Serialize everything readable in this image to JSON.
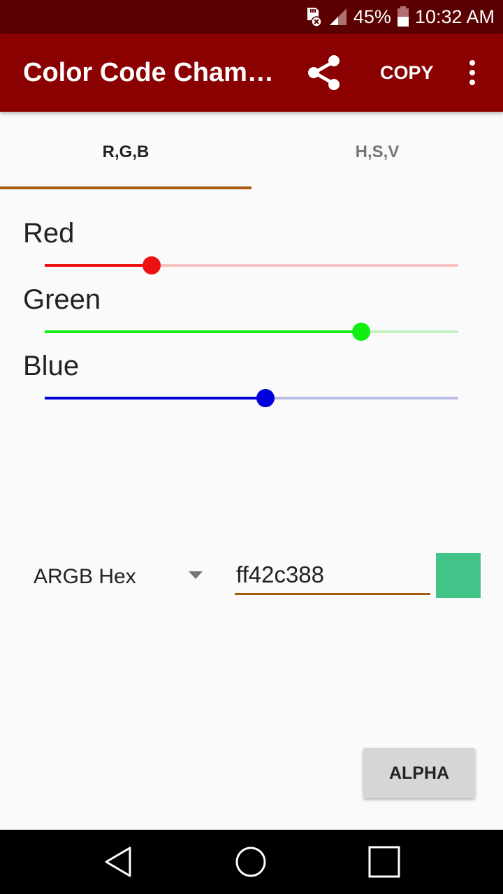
{
  "status_bar": {
    "battery_percent": "45%",
    "time": "10:32 AM",
    "icons": [
      "sd-card-error-icon",
      "signal-icon",
      "battery-icon"
    ]
  },
  "app_bar": {
    "title": "Color Code Champion",
    "share_icon": "share-icon",
    "copy_label": "COPY",
    "more_icon": "more-vert-icon"
  },
  "tabs": [
    {
      "label": "R,G,B",
      "active": true
    },
    {
      "label": "H,S,V",
      "active": false
    }
  ],
  "sliders": [
    {
      "label": "Red",
      "value": 66,
      "max": 255,
      "color": "#ee1111",
      "track_color": "#f7c2c2"
    },
    {
      "label": "Green",
      "value": 195,
      "max": 255,
      "color": "#11ee11",
      "track_color": "#c2f2c2"
    },
    {
      "label": "Blue",
      "value": 136,
      "max": 255,
      "color": "#0000dd",
      "track_color": "#bcbcea"
    }
  ],
  "format_selector": {
    "selected": "ARGB Hex"
  },
  "hex_input": {
    "value": "ff42c388"
  },
  "swatch_color": "#42c388",
  "alpha_button": {
    "label": "ALPHA"
  },
  "nav_bar": {
    "back": "back-icon",
    "home": "home-icon",
    "recents": "recents-icon"
  },
  "colors": {
    "primary": "#8b0000",
    "primary_dark": "#5a0000",
    "accent": "#a65a0e"
  }
}
